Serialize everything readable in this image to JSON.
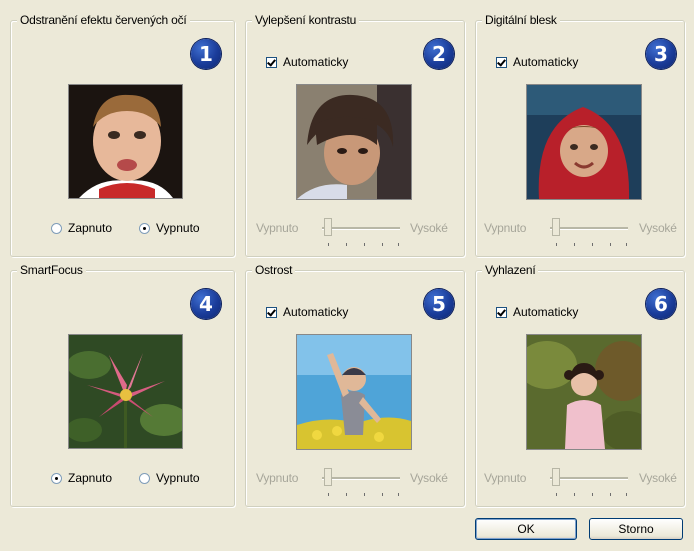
{
  "groups": [
    {
      "title": "Odstranění efektu červených očí",
      "number": "1"
    },
    {
      "title": "Vylepšení kontrastu",
      "number": "2",
      "checkbox": "Automaticky",
      "slider_min": "Vypnuto",
      "slider_max": "Vysoké"
    },
    {
      "title": "Digitální blesk",
      "number": "3",
      "checkbox": "Automaticky",
      "slider_min": "Vypnuto",
      "slider_max": "Vysoké"
    },
    {
      "title": "SmartFocus",
      "number": "4"
    },
    {
      "title": "Ostrost",
      "number": "5",
      "checkbox": "Automaticky",
      "slider_min": "Vypnuto",
      "slider_max": "Vysoké"
    },
    {
      "title": "Vyhlazení",
      "number": "6",
      "checkbox": "Automaticky",
      "slider_min": "Vypnuto",
      "slider_max": "Vysoké"
    }
  ],
  "redeye": {
    "on_label": "Zapnuto",
    "off_label": "Vypnuto",
    "selected": "Vypnuto"
  },
  "smartfocus": {
    "on_label": "Zapnuto",
    "off_label": "Vypnuto",
    "selected": "Zapnuto"
  },
  "buttons": {
    "ok": "OK",
    "cancel": "Storno"
  },
  "colors": {
    "badge": "#1a3c9a",
    "background": "#ece9d8",
    "disabled_text": "#a7a69a"
  }
}
